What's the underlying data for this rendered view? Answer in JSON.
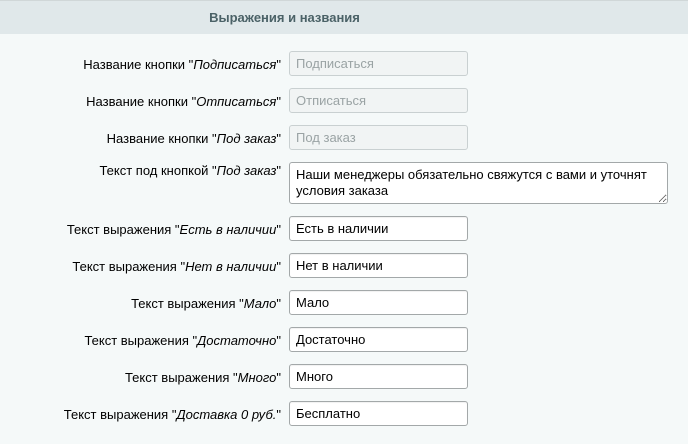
{
  "section": {
    "title": "Выражения и названия"
  },
  "fields": [
    {
      "label_prefix": "Название кнопки \"",
      "label_italic": "Подписаться",
      "label_suffix": "\"",
      "value": "",
      "placeholder": "Подписаться"
    },
    {
      "label_prefix": "Название кнопки \"",
      "label_italic": "Отписаться",
      "label_suffix": "\"",
      "value": "",
      "placeholder": "Отписаться"
    },
    {
      "label_prefix": "Название кнопки \"",
      "label_italic": "Под заказ",
      "label_suffix": "\"",
      "value": "",
      "placeholder": "Под заказ"
    },
    {
      "label_prefix": "Текст под кнопкой \"",
      "label_italic": "Под заказ",
      "label_suffix": "\"",
      "value": "Наши менеджеры обязательно свяжутся с вами и уточнят условия заказа"
    },
    {
      "label_prefix": "Текст выражения \"",
      "label_italic": "Есть в наличии",
      "label_suffix": "\"",
      "value": "Есть в наличии"
    },
    {
      "label_prefix": "Текст выражения \"",
      "label_italic": "Нет в наличии",
      "label_suffix": "\"",
      "value": "Нет в наличии"
    },
    {
      "label_prefix": "Текст выражения \"",
      "label_italic": "Мало",
      "label_suffix": "\"",
      "value": "Мало"
    },
    {
      "label_prefix": "Текст выражения \"",
      "label_italic": "Достаточно",
      "label_suffix": "\"",
      "value": "Достаточно"
    },
    {
      "label_prefix": "Текст выражения \"",
      "label_italic": "Много",
      "label_suffix": "\"",
      "value": "Много"
    },
    {
      "label_prefix": "Текст выражения \"",
      "label_italic": "Доставка 0 руб.",
      "label_suffix": "\"",
      "value": "Бесплатно"
    }
  ]
}
